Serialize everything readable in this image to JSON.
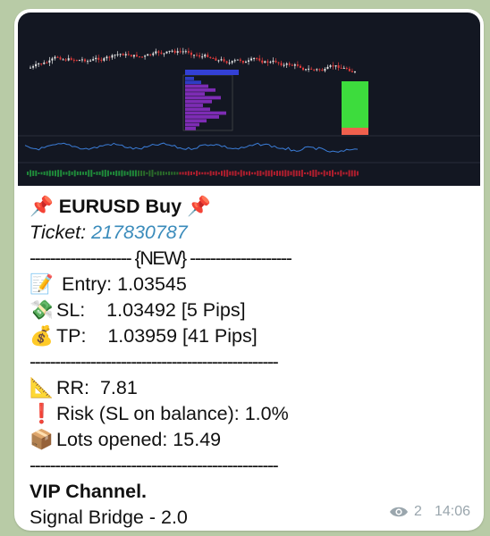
{
  "message": {
    "title_emoji_left": "📌",
    "title": "EURUSD Buy",
    "title_emoji_right": "📌",
    "ticket_label": "Ticket:",
    "ticket_number": "217830787",
    "new_divider": "-------------------- {NEW} --------------------",
    "entry_emoji": "📝",
    "entry": "Entry: 1.03545",
    "sl_emoji": "💸",
    "sl": "SL:    1.03492 [5 Pips]",
    "tp_emoji": "💰",
    "tp": "TP:    1.03959 [41 Pips]",
    "divider": "-------------------------------------------------",
    "rr_emoji": "📐",
    "rr": "RR:  7.81",
    "risk_emoji": "❗",
    "risk": "Risk (SL on balance): 1.0%",
    "lots_emoji": "📦",
    "lots": "Lots opened: 15.49",
    "channel": "VIP Channel.",
    "bridge": "Signal Bridge - 2.0"
  },
  "meta": {
    "views": "2",
    "time": "14:06"
  },
  "colors": {
    "chart_bg": "#131722",
    "link": "#3a8bbb",
    "tp_zone": "#3ddc3d",
    "sl_zone": "#f0604d"
  }
}
